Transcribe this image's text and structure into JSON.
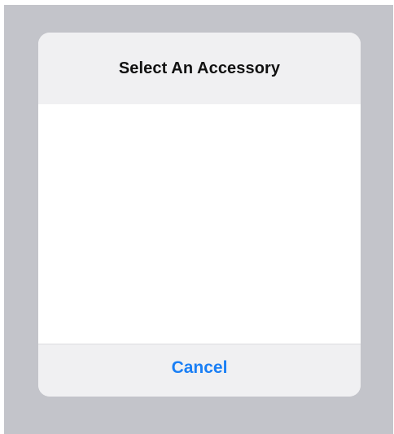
{
  "dialog": {
    "title": "Select An Accessory",
    "cancel_label": "Cancel"
  },
  "colors": {
    "backdrop": "#c3c4ca",
    "sheet": "#f0f0f2",
    "body": "#ffffff",
    "accent": "#1a7ff5"
  }
}
